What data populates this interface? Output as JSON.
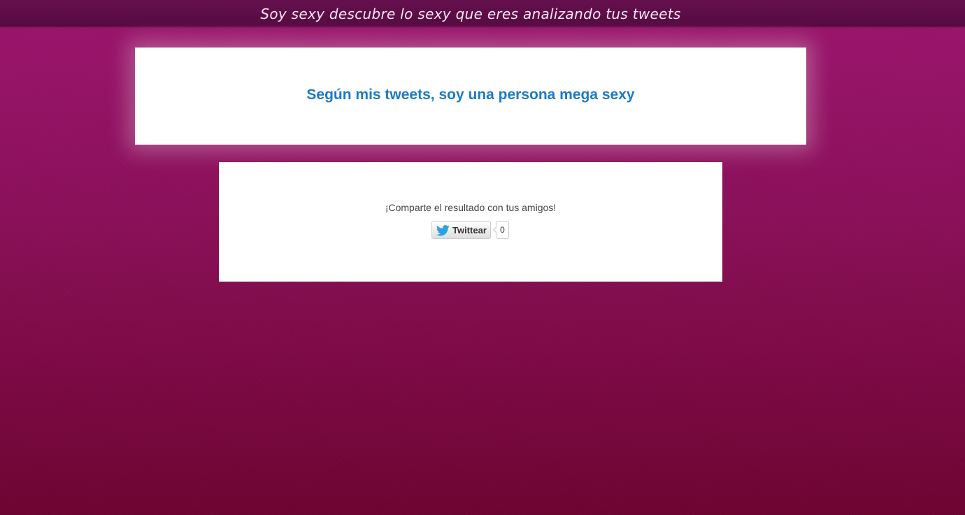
{
  "header": {
    "title": "Soy sexy descubre lo sexy que eres analizando tus tweets"
  },
  "result": {
    "text": "Según mis tweets, soy una persona mega sexy"
  },
  "share": {
    "text": "¡Comparte el resultado con tus amigos!",
    "tweet_button_label": "Twittear",
    "tweet_count": "0",
    "icon": "twitter-bird-icon"
  },
  "colors": {
    "background_top": "#9c146f",
    "background_bottom": "#6e0331",
    "header_bar": "#5b0c44",
    "result_text": "#1b7ac4",
    "twitter_blue": "#2ba3e0"
  }
}
